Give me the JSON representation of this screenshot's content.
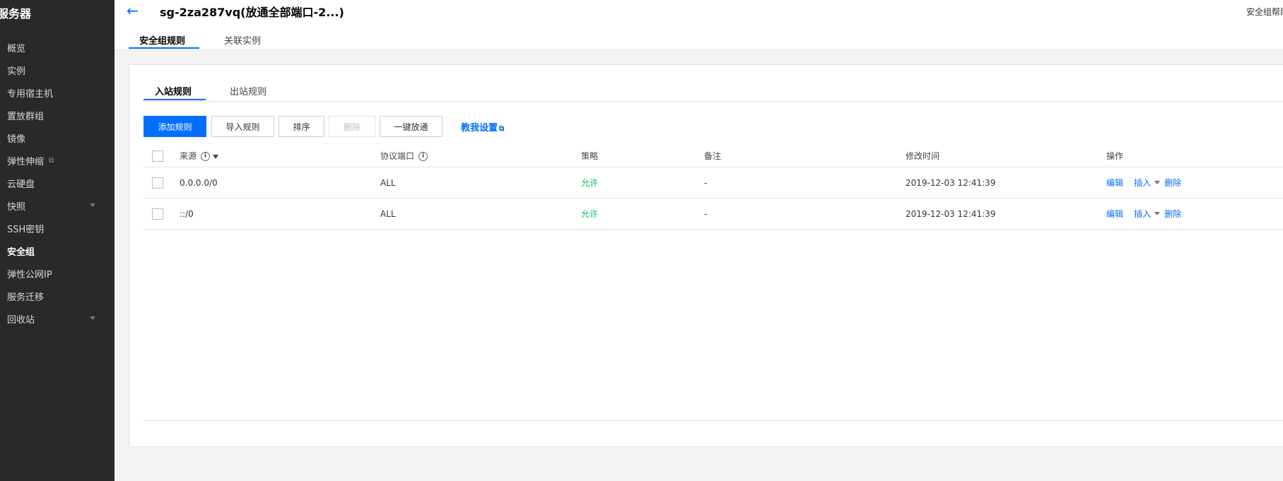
{
  "sidebar": {
    "title": "服务器",
    "items": [
      {
        "label": "概览"
      },
      {
        "label": "实例"
      },
      {
        "label": "专用宿主机"
      },
      {
        "label": "置放群组"
      },
      {
        "label": "镜像"
      },
      {
        "label": "弹性伸缩"
      },
      {
        "label": "云硬盘"
      },
      {
        "label": "快照"
      },
      {
        "label": "SSH密钥"
      },
      {
        "label": "安全组"
      },
      {
        "label": "弹性公网IP"
      },
      {
        "label": "服务迁移"
      },
      {
        "label": "回收站"
      }
    ]
  },
  "header": {
    "title": "sg-2za287vq(放通全部端口-2...)",
    "help_link": "安全组帮助",
    "tabs": [
      {
        "label": "安全组规则"
      },
      {
        "label": "关联实例"
      }
    ]
  },
  "rules": {
    "tabs": [
      {
        "label": "入站规则"
      },
      {
        "label": "出站规则"
      }
    ],
    "toolbar": {
      "add": "添加规则",
      "import": "导入规则",
      "sort": "排序",
      "delete": "删除",
      "allow_all": "一键放通",
      "guide": "教我设置"
    },
    "columns": {
      "source": "来源",
      "port": "协议端口",
      "policy": "策略",
      "remark": "备注",
      "modified": "修改时间",
      "ops": "操作"
    },
    "rows": [
      {
        "source": "0.0.0.0/0",
        "port": "ALL",
        "policy": "允许",
        "remark": "-",
        "modified": "2019-12-03 12:41:39"
      },
      {
        "source": "::/0",
        "port": "ALL",
        "policy": "允许",
        "remark": "-",
        "modified": "2019-12-03 12:41:39"
      }
    ],
    "ops": {
      "edit": "编辑",
      "insert": "插入",
      "delete": "删除"
    }
  }
}
